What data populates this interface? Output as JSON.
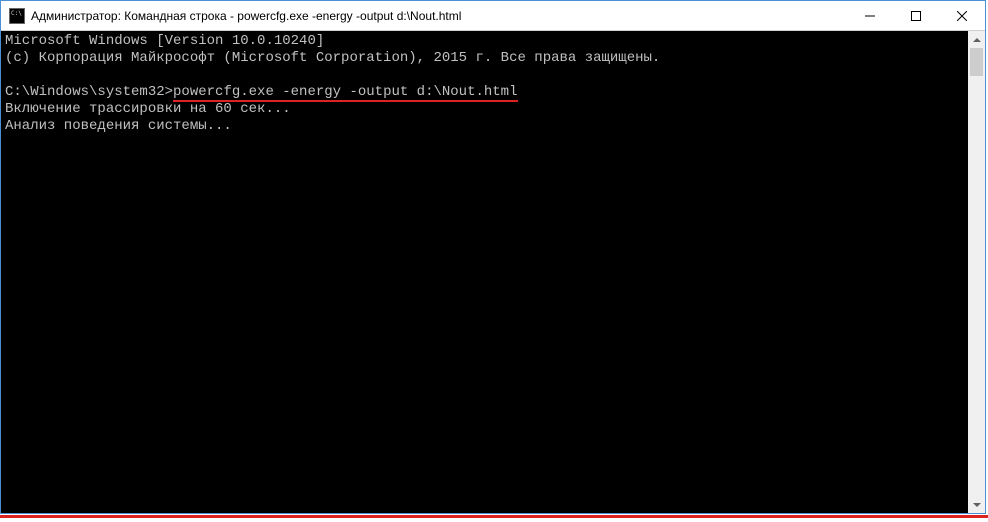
{
  "window": {
    "title": "Администратор: Командная строка - powercfg.exe  -energy -output d:\\Nout.html"
  },
  "console": {
    "line1": "Microsoft Windows [Version 10.0.10240]",
    "line2": "(c) Корпорация Майкрософт (Microsoft Corporation), 2015 г. Все права защищены.",
    "blank1": "",
    "prompt": "C:\\Windows\\system32>",
    "command": "powercfg.exe -energy -output d:\\Nout.html",
    "line4": "Включение трассировки на 60 сек...",
    "line5": "Анализ поведения системы..."
  }
}
